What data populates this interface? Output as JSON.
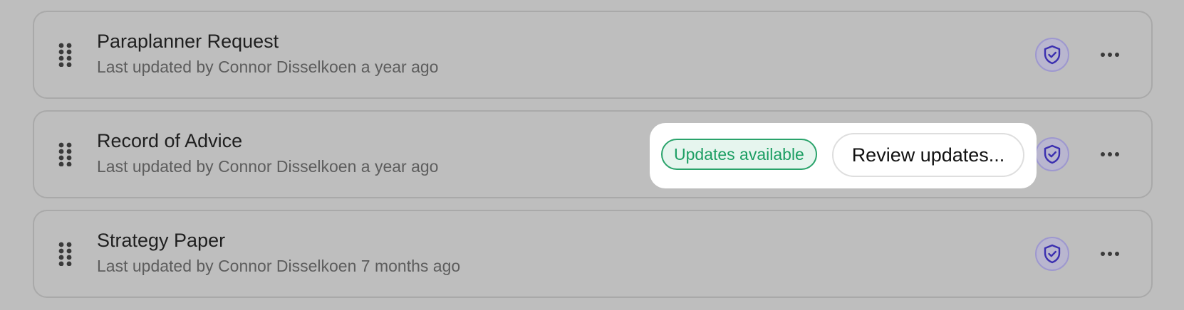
{
  "documents": [
    {
      "title": "Paraplanner Request",
      "subtitle": "Last updated by Connor Disselkoen a year ago"
    },
    {
      "title": "Record of Advice",
      "subtitle": "Last updated by Connor Disselkoen a year ago"
    },
    {
      "title": "Strategy Paper",
      "subtitle": "Last updated by Connor Disselkoen 7 months ago"
    }
  ],
  "popover": {
    "badge_label": "Updates available",
    "review_button_label": "Review updates..."
  },
  "icons": {
    "drag": "drag-handle-icon",
    "shield": "shield-check-icon",
    "more": "more-horizontal-icon"
  },
  "colors": {
    "shield_accent": "#3b2fb0",
    "badge_green": "#1c9e63"
  }
}
